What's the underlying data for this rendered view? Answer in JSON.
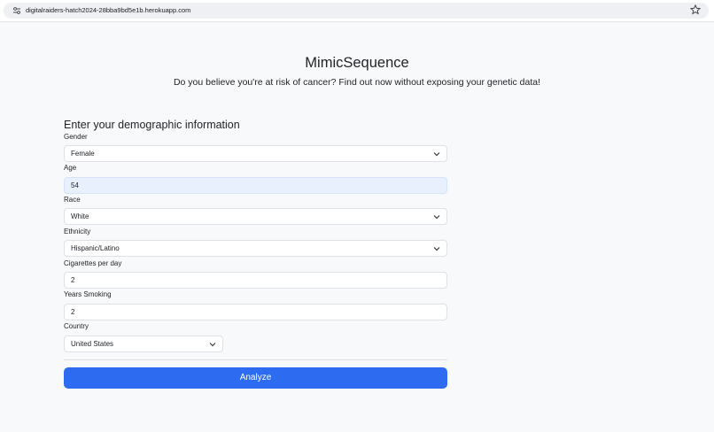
{
  "browser": {
    "url": "digitalraiders-hatch2024-28bba9bd5e1b.herokuapp.com"
  },
  "header": {
    "title": "MimicSequence",
    "subtitle": "Do you believe you're at risk of cancer? Find out now without exposing your genetic data!"
  },
  "form": {
    "heading": "Enter your demographic information",
    "gender": {
      "label": "Gender",
      "value": "Female"
    },
    "age": {
      "label": "Age",
      "value": "54"
    },
    "race": {
      "label": "Race",
      "value": "White"
    },
    "ethnicity": {
      "label": "Ethnicity",
      "value": "Hispanic/Latino"
    },
    "cigarettes": {
      "label": "Cigarettes per day",
      "value": "2"
    },
    "years": {
      "label": "Years Smoking",
      "value": "2"
    },
    "country": {
      "label": "Country",
      "value": "United States"
    },
    "submit_label": "Analyze"
  }
}
